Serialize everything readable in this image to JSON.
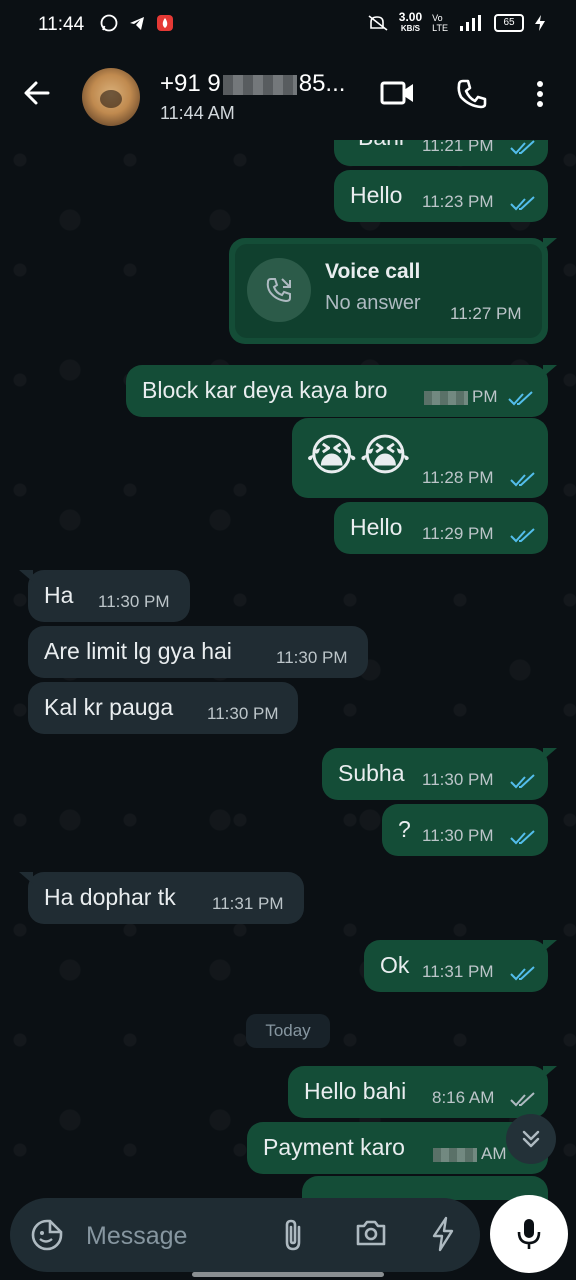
{
  "status_bar": {
    "time": "11:44",
    "speed_value": "3.00",
    "speed_unit": "KB/S",
    "network_top": "Vo",
    "network_bottom": "LTE",
    "battery": "65"
  },
  "header": {
    "name_prefix": "+91 9",
    "name_suffix": "85...",
    "status": "11:44 AM"
  },
  "messages": [
    {
      "dir": "out",
      "text": "Bahi",
      "time": "11:21 PM"
    },
    {
      "dir": "out",
      "text": "Hello",
      "time": "11:23 PM"
    },
    {
      "dir": "out",
      "type": "call",
      "title": "Voice call",
      "subtitle": "No answer",
      "time": "11:27 PM"
    },
    {
      "dir": "out",
      "text": "Block kar deya kaya bro",
      "time": "PM"
    },
    {
      "dir": "out",
      "text": "😭😭",
      "time": "11:28 PM"
    },
    {
      "dir": "out",
      "text": "Hello",
      "time": "11:29 PM"
    },
    {
      "dir": "in",
      "text": "Ha",
      "time": "11:30 PM"
    },
    {
      "dir": "in",
      "text": "Are limit lg gya hai",
      "time": "11:30 PM"
    },
    {
      "dir": "in",
      "text": "Kal kr pauga",
      "time": "11:30 PM"
    },
    {
      "dir": "out",
      "text": "Subha",
      "time": "11:30 PM"
    },
    {
      "dir": "out",
      "text": "?",
      "time": "11:30 PM"
    },
    {
      "dir": "in",
      "text": "Ha dophar tk",
      "time": "11:31 PM"
    },
    {
      "dir": "out",
      "text": "Ok",
      "time": "11:31 PM"
    },
    {
      "dir": "out",
      "text": "Hello bahi",
      "time": "8:16 AM"
    },
    {
      "dir": "out",
      "text": "Payment karo",
      "time": "AM"
    }
  ],
  "date_separator": "Today",
  "input": {
    "placeholder": "Message"
  },
  "colors": {
    "outgoing_bubble": "#144d37",
    "incoming_bubble": "#202c33",
    "read_ticks": "#53bdeb",
    "background": "#0b1014"
  },
  "icons": [
    "back-arrow-icon",
    "video-call-icon",
    "phone-icon",
    "more-vert-icon",
    "missed-call-icon",
    "double-check-icon",
    "chevron-down-icon",
    "sticker-icon",
    "attach-icon",
    "camera-icon",
    "bolt-icon",
    "mic-icon"
  ]
}
